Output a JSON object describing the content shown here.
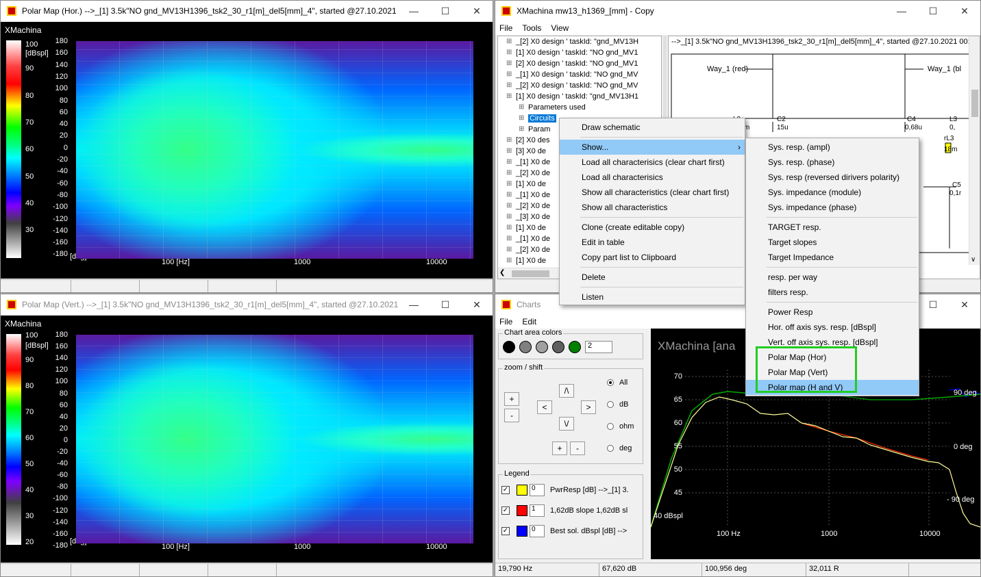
{
  "win_polar_h": {
    "title": "Polar Map (Hor.)  -->_[1] 3.5k\"NO gnd_MV13H1396_tsk2_30_r1[m]_del5[mm]_4\", started @27.10.2021 0...",
    "brand": "XMachina",
    "colorbar_ticks": [
      "100",
      "[dBspl]",
      "90",
      "80",
      "70",
      "60",
      "50",
      "40",
      "30"
    ],
    "y_ticks": [
      "180",
      "160",
      "140",
      "120",
      "100",
      "80",
      "60",
      "40",
      "20",
      "0",
      "-20",
      "-40",
      "-60",
      "-80",
      "-100",
      "-120",
      "-140",
      "-160",
      "-180"
    ],
    "y_unit": "[deg]",
    "x_ticks": [
      "100 [Hz]",
      "1000",
      "10000"
    ]
  },
  "win_polar_v": {
    "title": "Polar Map (Vert.)  -->_[1] 3.5k\"NO gnd_MV13H1396_tsk2_30_r1[m]_del5[mm]_4\", started @27.10.2021 0...",
    "brand": "XMachina",
    "colorbar_ticks": [
      "100",
      "[dBspl]",
      "90",
      "80",
      "70",
      "60",
      "50",
      "40",
      "30",
      "20"
    ],
    "y_ticks": [
      "180",
      "160",
      "140",
      "120",
      "100",
      "80",
      "60",
      "40",
      "20",
      "0",
      "-20",
      "-40",
      "-60",
      "-80",
      "-100",
      "-120",
      "-140",
      "-160",
      "-180"
    ],
    "y_unit": "[deg]",
    "x_ticks": [
      "100 [Hz]",
      "1000",
      "10000"
    ]
  },
  "win_main": {
    "title": "XMachina mw13_h1369_[mm] - Copy",
    "menu": [
      "File",
      "Tools",
      "View"
    ],
    "tree": [
      "_[2] X0 design ' taskId: \"gnd_MV13H",
      "[1] X0 design ' taskId: \"NO gnd_MV1",
      "[2] X0 design ' taskId: \"NO gnd_MV1",
      "_[1] X0 design ' taskId: \"NO gnd_MV",
      "_[2] X0 design ' taskId: \"NO gnd_MV",
      "[1] X0 design ' taskId: \"gnd_MV13H1",
      "Parameters used",
      "Circuits",
      "Param",
      "[2] X0 des",
      "[3] X0 de",
      "_[1] X0 de",
      "_[2] X0 de",
      "[1] X0 de",
      "_[1] X0 de",
      "_[2] X0 de",
      "_[3] X0 de",
      "[1] X0 de",
      "_[1] X0 de",
      "_[2] X0 de",
      "[1] X0 de"
    ],
    "schematic_title": "-->_[1] 3.5k\"NO gnd_MV13H1396_tsk2_30_r1[m]_del5[mm]_4\", started @27.10.2021 00:42:11",
    "way_left": "Way_1 (red)",
    "way_right": "Way_1 (bl",
    "c2_label": "C2",
    "c2_value": "15u",
    "c4_label": "C4",
    "c4_value": "0,68u",
    "l3_label": "L3",
    "l3_value": "0,",
    "rl3_label": "rL3",
    "rl3_value": "18m",
    "c5_label": "C5",
    "c5_value": "0,1r",
    "l2_label": "L2",
    "l2_value": "m"
  },
  "context_menu": {
    "items": [
      "Draw schematic",
      "Show...",
      "Load all characterisics (clear chart first)",
      "Load all characterisics",
      "Show all characteristics (clear chart first)",
      "Show all characteristics",
      "Clone (create editable copy)",
      "Edit in table",
      "Copy part list to Clipboard",
      "Delete",
      "Listen"
    ]
  },
  "submenu": {
    "items": [
      "Sys. resp. (ampl)",
      "Sys. resp. (phase)",
      "Sys. resp (reversed dirivers polarity)",
      "Sys. impedance (module)",
      "Sys. impedance (phase)",
      "TARGET resp.",
      "Target slopes",
      "Target Impedance",
      "resp. per way",
      "filters resp.",
      "Power Resp",
      "Hor.  off axis sys. resp. [dBspl]",
      "Vert.  off axis sys. resp. [dBspl]",
      "Polar Map (Hor)",
      "Polar Map (Vert)",
      "Polar map (H and V)"
    ],
    "highlight_color": "#22cc22"
  },
  "win_charts": {
    "title": "Charts",
    "menu": [
      "File",
      "Edit"
    ],
    "area_colors_label": "Chart area colors",
    "area_colors": [
      "#000000",
      "#808080",
      "#a0a0a0",
      "#606060",
      "#008000"
    ],
    "area_count": "2",
    "zoom_label": "zoom / shift",
    "plus": "+",
    "minus": "-",
    "up": "/\\",
    "down": "\\/",
    "left": "<",
    "right": ">",
    "radios": [
      "All",
      "dB",
      "ohm",
      "deg"
    ],
    "radio_selected": "All",
    "legend_label": "Legend",
    "legend": [
      {
        "color": "#ffff00",
        "num": "0",
        "text": "PwrResp [dB] -->_[1] 3."
      },
      {
        "color": "#ff0000",
        "num": "1",
        "text": "1,62dB slope 1,62dB sl"
      },
      {
        "color": "#0000ff",
        "num": "0",
        "text": "Best sol. dBspl [dB] -->"
      }
    ],
    "chart_title": "XMachina  [ana",
    "y_left_ticks": [
      "70",
      "65",
      "60",
      "55",
      "50",
      "45"
    ],
    "y_left_unit": "40 dBspl",
    "y_right_ticks": [
      "90 deg",
      "0 deg",
      "- 90 deg"
    ],
    "x_ticks": [
      "100 Hz",
      "1000",
      "10000"
    ],
    "status": [
      "19,790 Hz",
      "67,620 dB",
      "100,956 deg",
      "32,011 R"
    ]
  }
}
